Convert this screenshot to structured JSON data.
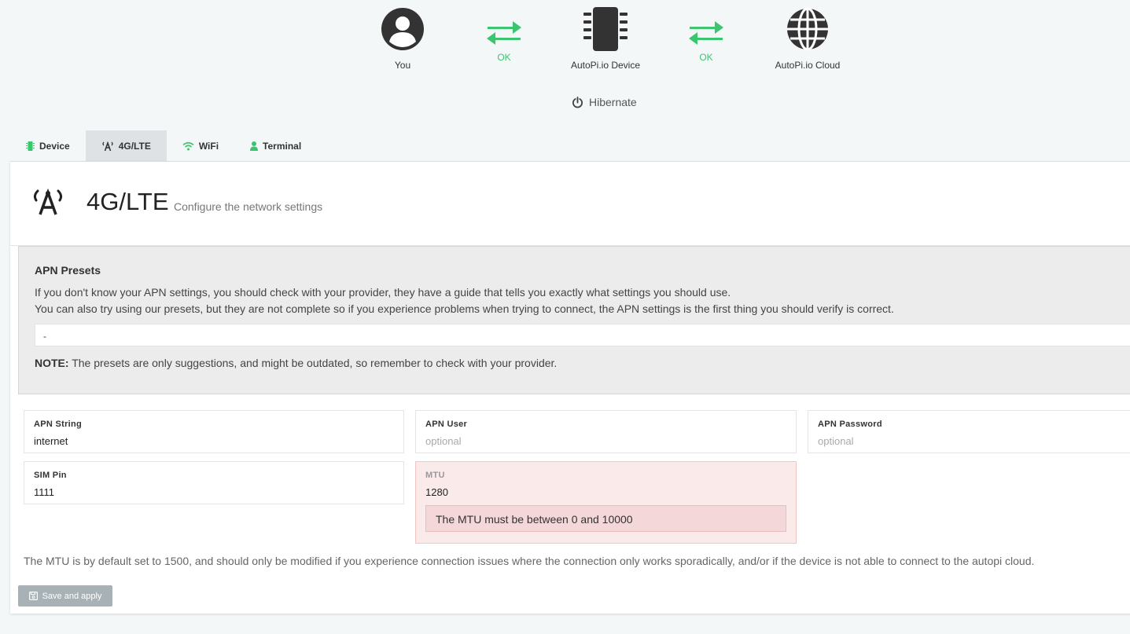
{
  "status": {
    "you_label": "You",
    "link1_status": "OK",
    "device_label": "AutoPi.io Device",
    "link2_status": "OK",
    "cloud_label": "AutoPi.io Cloud",
    "hibernate_label": "Hibernate",
    "ok_color": "#3cc56f"
  },
  "tabs": [
    {
      "label": "Device",
      "icon": "chip-icon"
    },
    {
      "label": "4G/LTE",
      "icon": "antenna-icon",
      "active": true
    },
    {
      "label": "WiFi",
      "icon": "wifi-icon"
    },
    {
      "label": "Terminal",
      "icon": "user-icon"
    }
  ],
  "page": {
    "title": "4G/LTE",
    "subtitle": "Configure the network settings"
  },
  "presets": {
    "heading": "APN Presets",
    "line1": "If you don't know your APN settings, you should check with your provider, they have a guide that tells you exactly what settings you should use.",
    "line2": "You can also try using our presets, but they are not complete so if you experience problems when trying to connect, the APN settings is the first thing you should verify is correct.",
    "selected": "-",
    "note_label": "NOTE:",
    "note_text": " The presets are only suggestions, and might be outdated, so remember to check with your provider."
  },
  "fields": {
    "apn_string": {
      "label": "APN String",
      "value": "internet",
      "placeholder": ""
    },
    "apn_user": {
      "label": "APN User",
      "value": "",
      "placeholder": "optional"
    },
    "apn_password": {
      "label": "APN Password",
      "value": "",
      "placeholder": "optional"
    },
    "sim_pin": {
      "label": "SIM Pin",
      "value": "1111",
      "placeholder": ""
    },
    "mtu": {
      "label": "MTU",
      "value": "1280",
      "placeholder": "",
      "error": "The MTU must be between 0 and 10000"
    }
  },
  "mtu_note": "The MTU is by default set to 1500, and should only be modified if you experience connection issues where the connection only works sporadically, and/or if the device is not able to connect to the autopi cloud.",
  "save_label": "Save and apply"
}
